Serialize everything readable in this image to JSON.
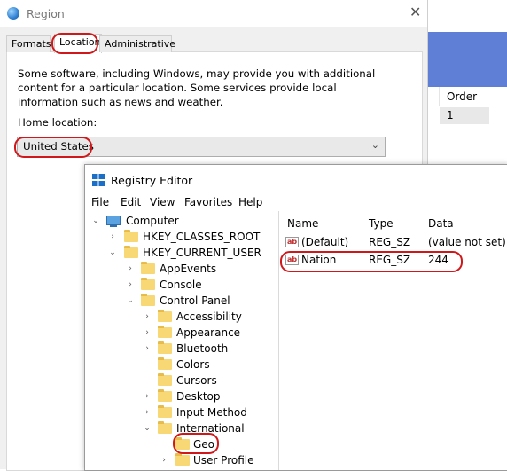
{
  "background_app": {
    "column_header": "Order",
    "cell_value": "1",
    "accent_color": "#5f7fd6"
  },
  "region": {
    "title": "Region",
    "close_glyph": "✕",
    "tabs": [
      "Formats",
      "Location",
      "Administrative"
    ],
    "active_tab": "Location",
    "description": "Some software, including Windows, may provide you with additional content for a particular location. Some services provide local information such as news and weather.",
    "home_location_label": "Home location:",
    "home_location_value": "United States",
    "chevron": "⌄"
  },
  "registry": {
    "title": "Registry Editor",
    "menu": [
      "File",
      "Edit",
      "View",
      "Favorites",
      "Help"
    ],
    "tree": [
      {
        "label": "Computer",
        "icon": "computer-icon",
        "twisty": "v"
      },
      {
        "label": "HKEY_CLASSES_ROOT",
        "icon": "folder-icon",
        "twisty": ">"
      },
      {
        "label": "HKEY_CURRENT_USER",
        "icon": "folder-icon",
        "twisty": "v"
      },
      {
        "label": "AppEvents",
        "icon": "folder-icon",
        "twisty": ">"
      },
      {
        "label": "Console",
        "icon": "folder-icon",
        "twisty": ">"
      },
      {
        "label": "Control Panel",
        "icon": "folder-icon",
        "twisty": "v"
      },
      {
        "label": "Accessibility",
        "icon": "folder-icon",
        "twisty": ">"
      },
      {
        "label": "Appearance",
        "icon": "folder-icon",
        "twisty": ">"
      },
      {
        "label": "Bluetooth",
        "icon": "folder-icon",
        "twisty": ">"
      },
      {
        "label": "Colors",
        "icon": "folder-icon",
        "twisty": ""
      },
      {
        "label": "Cursors",
        "icon": "folder-icon",
        "twisty": ""
      },
      {
        "label": "Desktop",
        "icon": "folder-icon",
        "twisty": ">"
      },
      {
        "label": "Input Method",
        "icon": "folder-icon",
        "twisty": ">"
      },
      {
        "label": "International",
        "icon": "folder-icon",
        "twisty": "v"
      },
      {
        "label": "Geo",
        "icon": "folder-icon",
        "twisty": ""
      },
      {
        "label": "User Profile",
        "icon": "folder-icon",
        "twisty": ">"
      }
    ],
    "columns": [
      "Name",
      "Type",
      "Data"
    ],
    "values": [
      {
        "name": "(Default)",
        "type": "REG_SZ",
        "data": "(value not set)"
      },
      {
        "name": "Nation",
        "type": "REG_SZ",
        "data": "244"
      }
    ],
    "highlight_color": "#d0171a"
  }
}
